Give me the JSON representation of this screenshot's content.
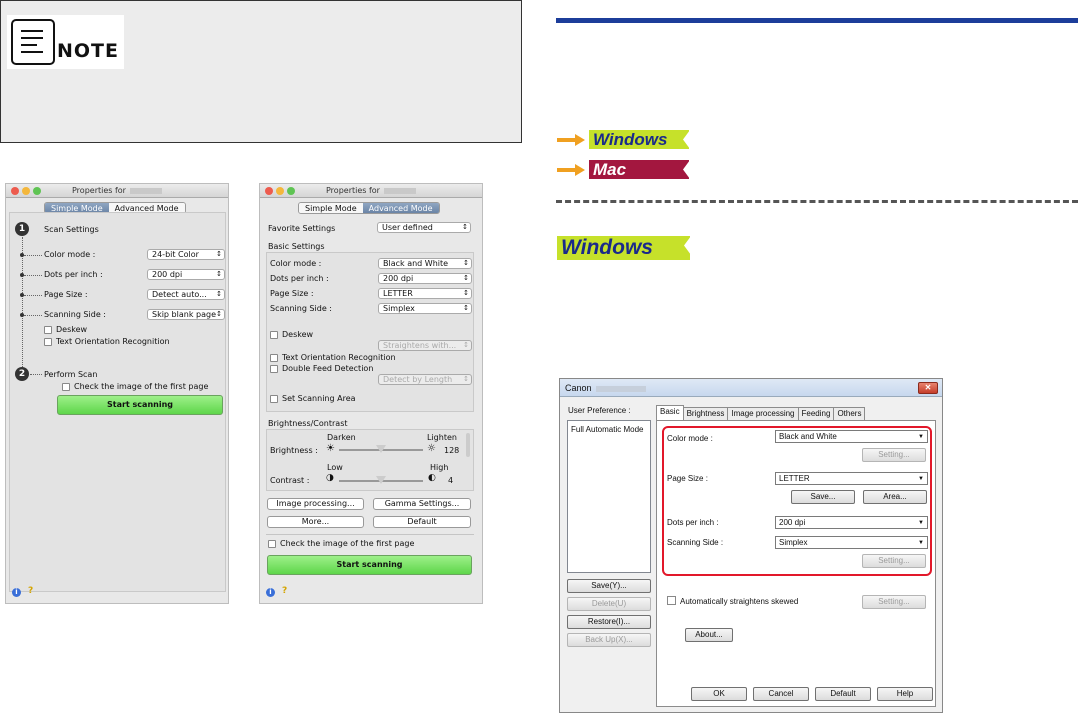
{
  "note": {
    "label": "NOTE",
    "icon": "note-document-pencil-icon"
  },
  "mac_simple": {
    "title": "Properties for",
    "tabs": [
      "Simple Mode",
      "Advanced Mode"
    ],
    "step1": {
      "number": "1",
      "label": "Scan Settings"
    },
    "settings": [
      {
        "label": "Color mode :",
        "value": "24-bit Color"
      },
      {
        "label": "Dots per inch :",
        "value": "200 dpi"
      },
      {
        "label": "Page Size :",
        "value": "Detect auto..."
      },
      {
        "label": "Scanning Side :",
        "value": "Skip blank page"
      }
    ],
    "deskew": "Deskew",
    "text_orientation": "Text Orientation Recognition",
    "step2": {
      "number": "2",
      "label": "Perform Scan"
    },
    "check_first": "Check the image of the first page",
    "start": "Start scanning"
  },
  "mac_advanced": {
    "title": "Properties for",
    "tabs": [
      "Simple Mode",
      "Advanced Mode"
    ],
    "favorite_label": "Favorite Settings",
    "favorite_value": "User defined",
    "basic_heading": "Basic Settings",
    "settings": [
      {
        "label": "Color mode :",
        "value": "Black and White"
      },
      {
        "label": "Dots per inch :",
        "value": "200 dpi"
      },
      {
        "label": "Page Size :",
        "value": "LETTER"
      },
      {
        "label": "Scanning Side :",
        "value": "Simplex"
      }
    ],
    "deskew": "Deskew",
    "deskew_option": "Straightens with...",
    "text_orientation": "Text Orientation Recognition",
    "double_feed": "Double Feed Detection",
    "double_feed_option": "Detect by Length",
    "scan_area": "Set Scanning Area",
    "bc_heading": "Brightness/Contrast",
    "darken": "Darken",
    "lighten": "Lighten",
    "brightness_label": "Brightness :",
    "brightness_value": "128",
    "low": "Low",
    "high": "High",
    "contrast_label": "Contrast :",
    "contrast_value": "4",
    "btn_image_processing": "Image processing...",
    "btn_gamma": "Gamma Settings...",
    "btn_more": "More...",
    "btn_default": "Default",
    "check_first": "Check the image of the first page",
    "start": "Start scanning"
  },
  "platform_tags": {
    "windows": "Windows",
    "mac": "Mac",
    "windows_heading": "Windows"
  },
  "colors": {
    "windows_tag_bg": "#c6e12a",
    "windows_tag_text": "#1a2a8a",
    "mac_tag_bg": "#a3173f",
    "mac_tag_text": "#ffffff",
    "heading_bar": "#1c3d9a",
    "highlight": "#e2182a"
  },
  "win_dialog": {
    "title": "Canon",
    "user_pref_label": "User Preference :",
    "user_pref_items": [
      "Full Automatic Mode"
    ],
    "tabs": [
      "Basic",
      "Brightness",
      "Image processing",
      "Feeding",
      "Others"
    ],
    "color_mode_label": "Color mode :",
    "color_mode_value": "Black and White",
    "page_size_label": "Page Size :",
    "page_size_value": "LETTER",
    "dpi_label": "Dots per inch :",
    "dpi_value": "200 dpi",
    "side_label": "Scanning Side :",
    "side_value": "Simplex",
    "setting": "Setting...",
    "save": "Save...",
    "area": "Area...",
    "auto_skew": "Automatically straightens skewed",
    "about": "About...",
    "left_buttons": [
      "Save(Y)...",
      "Delete(U)",
      "Restore(I)...",
      "Back Up(X)..."
    ],
    "ok": "OK",
    "cancel": "Cancel",
    "default": "Default",
    "help": "Help"
  }
}
